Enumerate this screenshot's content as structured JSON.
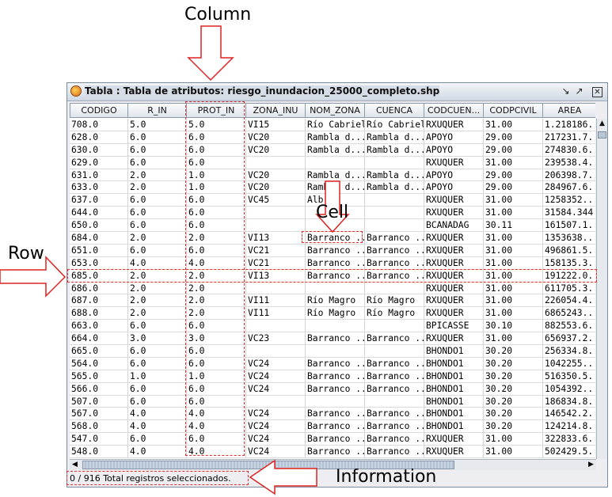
{
  "annotations": {
    "column": "Column",
    "cell": "Cell",
    "row": "Row",
    "information": "Information"
  },
  "window": {
    "title": "Tabla : Tabla de atributos: riesgo_inundacion_25000_completo.shp",
    "status": "0 / 916 Total registros seleccionados."
  },
  "table": {
    "columns": [
      "CODIGO",
      "R_IN",
      "PROT_IN",
      "ZONA_INU",
      "NOM_ZONA",
      "CUENCA",
      "CODCUEN...",
      "CODPCIVIL",
      "AREA"
    ],
    "rows": [
      [
        "708.0",
        "5.0",
        "5.0",
        "VI15",
        "Río Cabriel",
        "Río Cabriel",
        "RXUQUER",
        "31.00",
        "1.218186..."
      ],
      [
        "628.0",
        "6.0",
        "6.0",
        "VC20",
        "Rambla d...",
        "Rambla d...",
        "APOYO",
        "29.00",
        "217231.7..."
      ],
      [
        "630.0",
        "6.0",
        "6.0",
        "VC20",
        "Rambla d...",
        "Rambla d...",
        "APOYO",
        "29.00",
        "274830.6..."
      ],
      [
        "629.0",
        "6.0",
        "6.0",
        "",
        "",
        "",
        "RXUQUER",
        "31.00",
        "239538.4..."
      ],
      [
        "631.0",
        "2.0",
        "1.0",
        "VC20",
        "Rambla d...",
        "Rambla d...",
        "APOYO",
        "29.00",
        "206398.7..."
      ],
      [
        "633.0",
        "2.0",
        "1.0",
        "VC20",
        "Rambla d...",
        "Rambla d...",
        "APOYO",
        "29.00",
        "284967.6..."
      ],
      [
        "637.0",
        "6.0",
        "6.0",
        "VC45",
        "Alb...",
        "",
        "RXUQUER",
        "31.00",
        "1258352..."
      ],
      [
        "644.0",
        "6.0",
        "6.0",
        "",
        "",
        "",
        "RXUQUER",
        "31.00",
        "31584.344"
      ],
      [
        "650.0",
        "6.0",
        "6.0",
        "",
        "",
        "",
        "BCANADAG",
        "30.11",
        "161507.1..."
      ],
      [
        "684.0",
        "2.0",
        "2.0",
        "VI13",
        "Barranco ...",
        "Barranco ...",
        "RXUQUER",
        "31.00",
        "1353638..."
      ],
      [
        "651.0",
        "6.0",
        "6.0",
        "VC21",
        "Barranco ...",
        "Barranco ...",
        "RXUQUER",
        "31.00",
        "496861.5..."
      ],
      [
        "653.0",
        "4.0",
        "4.0",
        "VC21",
        "Barranco ...",
        "Barranco ...",
        "RXUQUER",
        "31.00",
        "158135.3..."
      ],
      [
        "685.0",
        "2.0",
        "2.0",
        "VI13",
        "Barranco ...",
        "Barranco ...",
        "RXUQUER",
        "31.00",
        "191222.0..."
      ],
      [
        "686.0",
        "2.0",
        "2.0",
        "",
        "",
        "",
        "RXUQUER",
        "31.00",
        "611705.3..."
      ],
      [
        "687.0",
        "2.0",
        "2.0",
        "VI11",
        "Río Magro",
        "Río Magro",
        "RXUQUER",
        "31.00",
        "226054.4..."
      ],
      [
        "688.0",
        "2.0",
        "2.0",
        "VI11",
        "Río Magro",
        "Río Magro",
        "RXUQUER",
        "31.00",
        "6865243..."
      ],
      [
        "663.0",
        "6.0",
        "6.0",
        "",
        "",
        "",
        "BPICASSE",
        "30.10",
        "882553.6..."
      ],
      [
        "664.0",
        "3.0",
        "3.0",
        "VC23",
        "Barranco ...",
        "Barranco ...",
        "RXUQUER",
        "31.00",
        "656937.2..."
      ],
      [
        "665.0",
        "6.0",
        "6.0",
        "",
        "",
        "",
        "BHONDO1",
        "30.20",
        "256334.8..."
      ],
      [
        "564.0",
        "6.0",
        "6.0",
        "VC24",
        "Barranco ...",
        "Barranco ...",
        "BHONDO1",
        "30.20",
        "1042255..."
      ],
      [
        "565.0",
        "1.0",
        "1.0",
        "VC24",
        "Barranco ...",
        "Barranco ...",
        "BHONDO1",
        "30.20",
        "516350.5..."
      ],
      [
        "566.0",
        "6.0",
        "6.0",
        "VC24",
        "Barranco ...",
        "Barranco ...",
        "BHONDO1",
        "30.20",
        "1054392..."
      ],
      [
        "507.0",
        "6.0",
        "6.0",
        "",
        "",
        "",
        "BHONDO1",
        "30.20",
        "186834.8..."
      ],
      [
        "567.0",
        "4.0",
        "4.0",
        "VC24",
        "Barranco ...",
        "Barranco ...",
        "BHONDO1",
        "30.20",
        "146542.2..."
      ],
      [
        "568.0",
        "4.0",
        "4.0",
        "VC24",
        "Barranco ...",
        "Barranco ...",
        "BHONDO1",
        "30.20",
        "124214.8..."
      ],
      [
        "547.0",
        "6.0",
        "6.0",
        "VC24",
        "Barranco ...",
        "Barranco ...",
        "RXUQUER",
        "31.00",
        "322833.6..."
      ],
      [
        "548.0",
        "4.0",
        "4.0",
        "VC24",
        "Barranco ...",
        "Barranco ...",
        "RXUQUER",
        "31.00",
        "502429.5..."
      ]
    ]
  },
  "icons": [
    "app-icon",
    "minimize-icon",
    "maximize-icon",
    "close-icon",
    "scroll-up-icon",
    "scroll-left-icon",
    "scroll-right-icon"
  ],
  "colors": {
    "highlight": "#e23030",
    "arrow_fill": "#ffffff"
  }
}
